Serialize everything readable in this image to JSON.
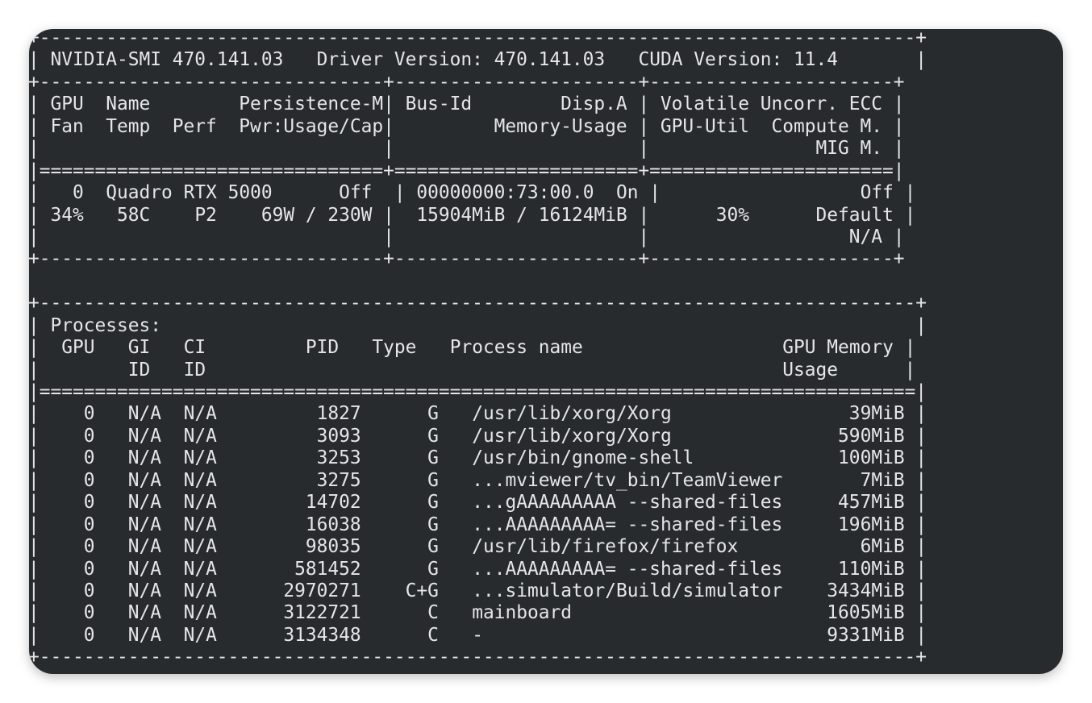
{
  "header": {
    "smi_version": "NVIDIA-SMI 470.141.03",
    "driver_version": "Driver Version: 470.141.03",
    "cuda_version": "CUDA Version: 11.4"
  },
  "gpu_table": {
    "header_rows": [
      "| GPU  Name        Persistence-M| Bus-Id        Disp.A | Volatile Uncorr. ECC |",
      "| Fan  Temp  Perf  Pwr:Usage/Cap|         Memory-Usage | GPU-Util  Compute M. |",
      "|                               |                      |               MIG M. |"
    ],
    "gpus": [
      {
        "index": "0",
        "name": "Quadro RTX 5000",
        "persistence": "Off",
        "bus_id": "00000000:73:00.0",
        "disp_a": "On",
        "ecc": "Off",
        "fan": "34%",
        "temp": "58C",
        "perf": "P2",
        "power": "69W / 230W",
        "memory_usage": "15904MiB / 16124MiB",
        "gpu_util": "30%",
        "compute_mode": "Default",
        "mig_mode": "N/A"
      }
    ]
  },
  "processes": {
    "title": "Processes:",
    "columns": [
      "GPU",
      "GI",
      "CI",
      "PID",
      "Type",
      "Process name",
      "GPU Memory"
    ],
    "columns_sub": [
      "",
      "ID",
      "ID",
      "",
      "",
      "",
      "Usage"
    ],
    "rows": [
      {
        "gpu": "0",
        "gi": "N/A",
        "ci": "N/A",
        "pid": "1827",
        "type": "G",
        "name": "/usr/lib/xorg/Xorg",
        "mem": "39MiB"
      },
      {
        "gpu": "0",
        "gi": "N/A",
        "ci": "N/A",
        "pid": "3093",
        "type": "G",
        "name": "/usr/lib/xorg/Xorg",
        "mem": "590MiB"
      },
      {
        "gpu": "0",
        "gi": "N/A",
        "ci": "N/A",
        "pid": "3253",
        "type": "G",
        "name": "/usr/bin/gnome-shell",
        "mem": "100MiB"
      },
      {
        "gpu": "0",
        "gi": "N/A",
        "ci": "N/A",
        "pid": "3275",
        "type": "G",
        "name": "...mviewer/tv_bin/TeamViewer",
        "mem": "7MiB"
      },
      {
        "gpu": "0",
        "gi": "N/A",
        "ci": "N/A",
        "pid": "14702",
        "type": "G",
        "name": "...gAAAAAAAAA --shared-files",
        "mem": "457MiB"
      },
      {
        "gpu": "0",
        "gi": "N/A",
        "ci": "N/A",
        "pid": "16038",
        "type": "G",
        "name": "...AAAAAAAAA= --shared-files",
        "mem": "196MiB"
      },
      {
        "gpu": "0",
        "gi": "N/A",
        "ci": "N/A",
        "pid": "98035",
        "type": "G",
        "name": "/usr/lib/firefox/firefox",
        "mem": "6MiB"
      },
      {
        "gpu": "0",
        "gi": "N/A",
        "ci": "N/A",
        "pid": "581452",
        "type": "G",
        "name": "...AAAAAAAAA= --shared-files",
        "mem": "110MiB"
      },
      {
        "gpu": "0",
        "gi": "N/A",
        "ci": "N/A",
        "pid": "2970271",
        "type": "C+G",
        "name": "...simulator/Build/simulator",
        "mem": "3434MiB"
      },
      {
        "gpu": "0",
        "gi": "N/A",
        "ci": "N/A",
        "pid": "3122721",
        "type": "C",
        "name": "mainboard",
        "mem": "1605MiB"
      },
      {
        "gpu": "0",
        "gi": "N/A",
        "ci": "N/A",
        "pid": "3134348",
        "type": "C",
        "name": "-",
        "mem": "9331MiB"
      }
    ]
  }
}
